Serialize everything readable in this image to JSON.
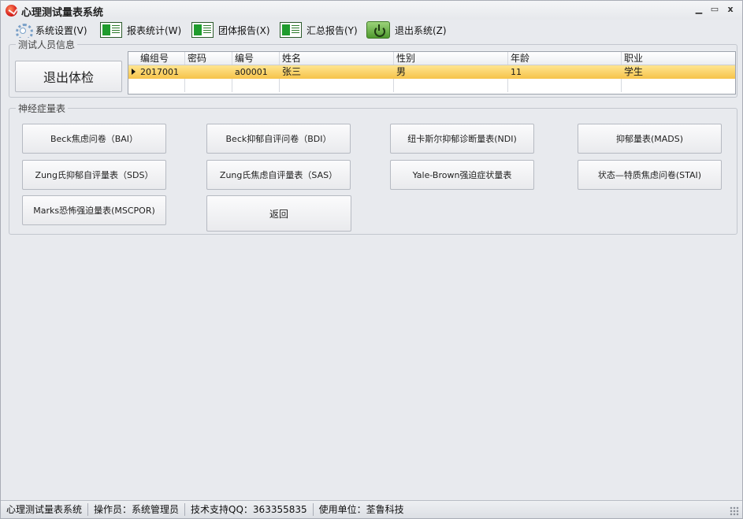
{
  "window": {
    "title": "心理测试量表系统",
    "minimize": "▁",
    "maximize": "▭",
    "close": "x"
  },
  "menu": [
    {
      "label": "系统设置(V)",
      "icon": "gear-icon"
    },
    {
      "label": "报表统计(W)",
      "icon": "report-icon"
    },
    {
      "label": "团体报告(X)",
      "icon": "report-icon"
    },
    {
      "label": "汇总报告(Y)",
      "icon": "report-icon"
    },
    {
      "label": "退出系统(Z)",
      "icon": "power-icon"
    }
  ],
  "person_info": {
    "legend": "测试人员信息",
    "exit_button": "退出体检",
    "columns": [
      "编组号",
      "密码",
      "编号",
      "姓名",
      "性别",
      "年龄",
      "职业"
    ],
    "rows": [
      [
        "2017001",
        "",
        "a00001",
        "张三",
        "男",
        "11",
        "学生"
      ]
    ]
  },
  "scales": {
    "legend": "神经症量表",
    "buttons": [
      "Beck焦虑问卷（BAI）",
      "Beck抑郁自评问卷（BDI）",
      "纽卡斯尔抑郁诊断量表(NDI)",
      "抑郁量表(MADS)",
      "Zung氏抑郁自评量表（SDS）",
      "Zung氏焦虑自评量表（SAS）",
      "Yale-Brown强迫症状量表",
      "状态—特质焦虑问卷(STAI)",
      "Marks恐怖强迫量表(MSCPOR)",
      "返回"
    ]
  },
  "status": [
    "心理测试量表系统",
    "操作员：系统管理员",
    "技术支持QQ：363355835",
    "使用单位：荃鲁科技"
  ]
}
